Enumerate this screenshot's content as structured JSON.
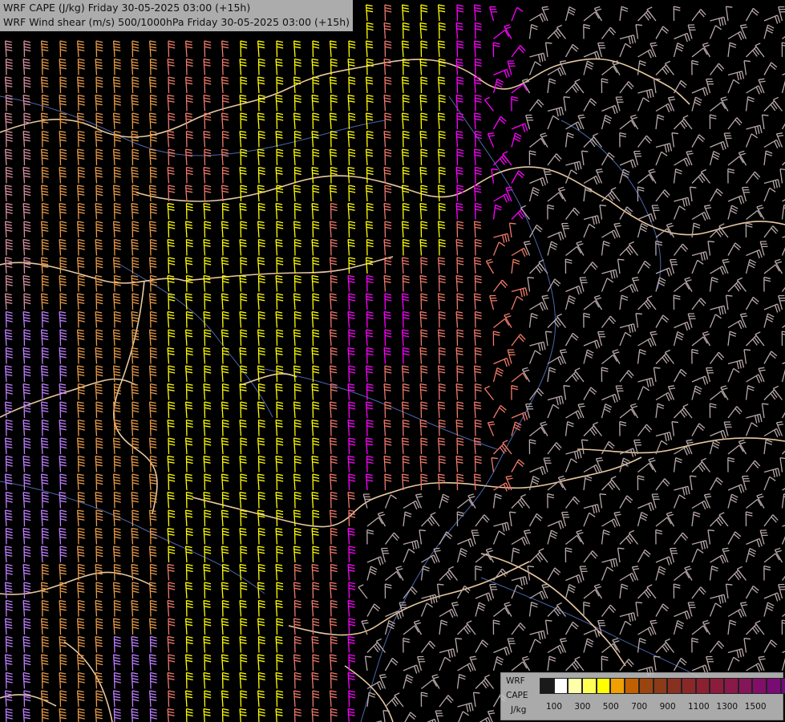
{
  "header": {
    "line1": "WRF CAPE (J/kg) Friday 30-05-2025 03:00 (+15h)",
    "line2": "WRF Wind shear (m/s) 500/1000hPa Friday 30-05-2025 03:00 (+15h)"
  },
  "legend": {
    "label_top": "WRF",
    "label_mid": "CAPE",
    "label_unit": "J/kg",
    "colors": [
      "#1a1a1a",
      "#ffffff",
      "#ffffaa",
      "#ffff55",
      "#ffff00",
      "#f0a000",
      "#c06000",
      "#9a4510",
      "#8c3a18",
      "#8a3020",
      "#8a2828",
      "#8c2030",
      "#8c1c3c",
      "#8a1848",
      "#861458",
      "#820e68",
      "#7a0a74",
      "#700a80"
    ],
    "ticks": [
      "100",
      "300",
      "500",
      "700",
      "900",
      "1100",
      "1300",
      "1500"
    ]
  },
  "map": {
    "barb_colors": {
      "yellow": "#ffff00",
      "magenta": "#ff00ff",
      "orange": "#e89a48",
      "salmon": "#f07a6a",
      "pink": "#d890a0",
      "mauve": "#c87aa0",
      "violet": "#c080ff",
      "grey": "#b8a8a8",
      "border": "#e8c8a0",
      "river": "#5a78c8"
    }
  }
}
